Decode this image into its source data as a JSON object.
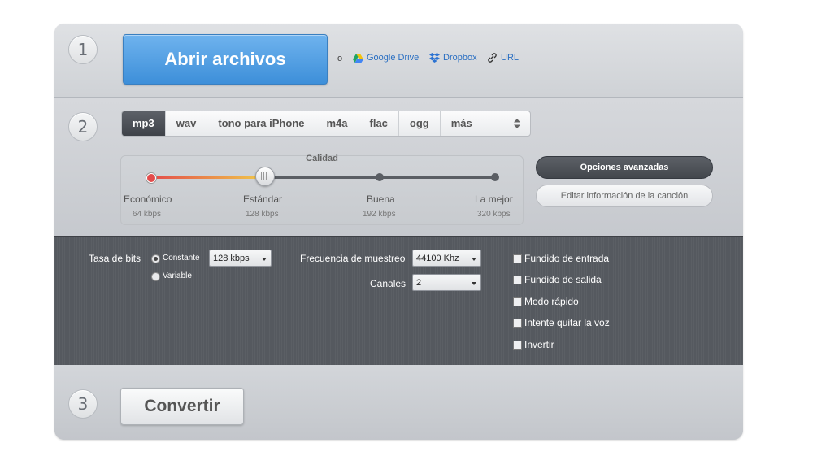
{
  "steps": {
    "one": "1",
    "two": "2",
    "three": "3"
  },
  "open": {
    "button_label": "Abrir archivos",
    "or_label": "o",
    "sources": [
      {
        "label": "Google Drive",
        "icon": "google-drive-icon"
      },
      {
        "label": "Dropbox",
        "icon": "dropbox-icon"
      },
      {
        "label": "URL",
        "icon": "link-icon"
      }
    ]
  },
  "formats": {
    "tabs": [
      "mp3",
      "wav",
      "tono para iPhone",
      "m4a",
      "flac",
      "ogg",
      "más"
    ],
    "selected": "mp3"
  },
  "quality": {
    "title": "Calidad",
    "selected_level": "Estándar",
    "levels": [
      {
        "label": "Económico",
        "rate": "64 kbps"
      },
      {
        "label": "Estándar",
        "rate": "128 kbps"
      },
      {
        "label": "Buena",
        "rate": "192 kbps"
      },
      {
        "label": "La mejor",
        "rate": "320 kbps"
      }
    ]
  },
  "buttons": {
    "advanced": "Opciones avanzadas",
    "edit_info": "Editar información de la canción",
    "convert": "Convertir"
  },
  "advanced": {
    "bitrate_label": "Tasa de bits",
    "bitrate_mode_constant": "Constante",
    "bitrate_mode_variable": "Variable",
    "bitrate_mode_selected": "Constante",
    "bitrate_value": "128 kbps",
    "sample_rate_label": "Frecuencia de muestreo",
    "sample_rate_value": "44100 Khz",
    "channels_label": "Canales",
    "channels_value": "2",
    "options": [
      "Fundido de entrada",
      "Fundido de salida",
      "Modo rápido",
      "Intente quitar la voz",
      "Invertir"
    ]
  },
  "colors": {
    "accent_blue": "#4a9be2",
    "dark_panel": "#55595f",
    "slider_start": "#e34b4b",
    "slider_mid": "#f0c94a"
  }
}
